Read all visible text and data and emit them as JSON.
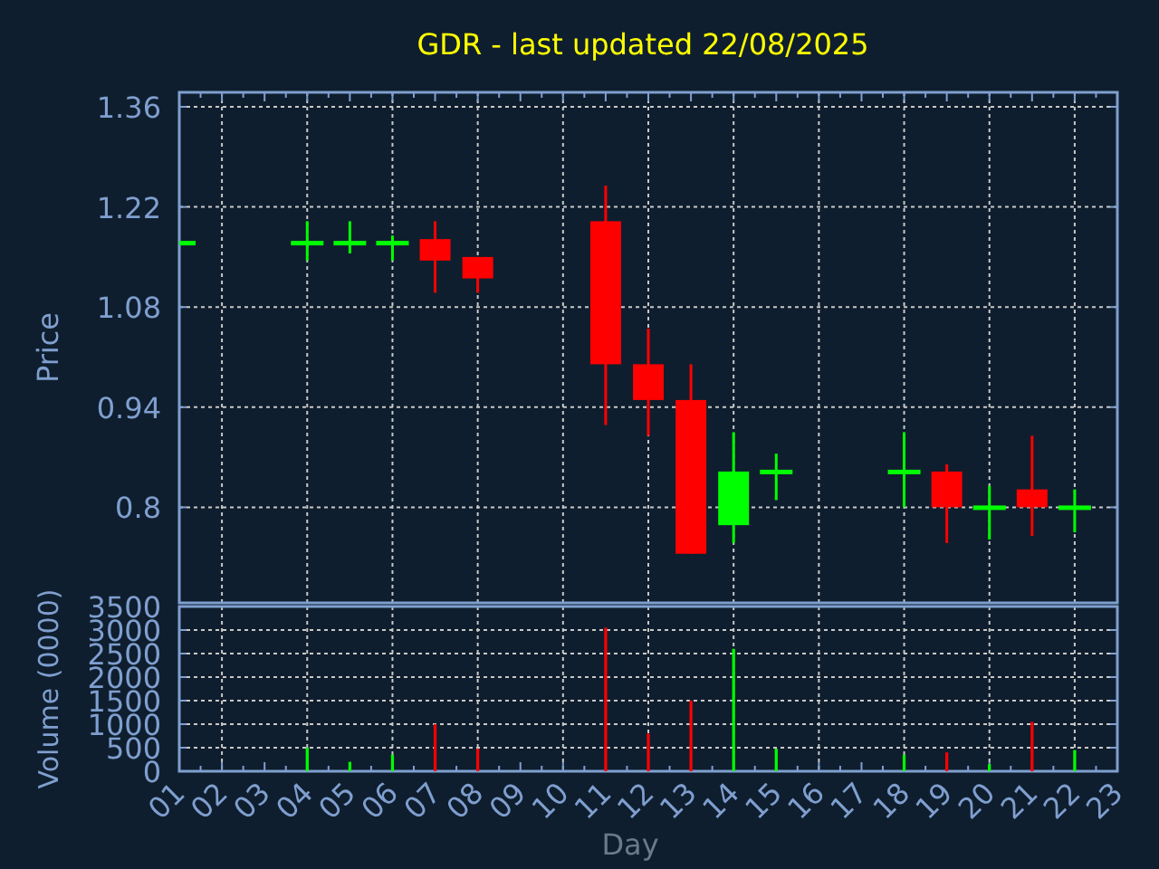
{
  "chart": {
    "title": "GDR - last updated 22/08/2025",
    "price_panel": {
      "ylabel": "Price",
      "ytick_labels": [
        "1.36",
        "1.22",
        "1.08",
        "0.94",
        "0.8"
      ]
    },
    "volume_panel": {
      "chart_data": {
        "type": "bar",
        "xlabel": "Day",
        "ylabel": "Volume (0000)",
        "grid": true,
        "categories": [
          "01",
          "02",
          "03",
          "04",
          "05",
          "06",
          "07",
          "08",
          "09",
          "10",
          "11",
          "12",
          "13",
          "14",
          "15",
          "16",
          "17",
          "18",
          "19",
          "20",
          "21",
          "22",
          "23"
        ],
        "series": [
          {
            "color": "#00ff00",
            "values": [
              null,
              null,
              null,
              500,
              200,
              350,
              null,
              null,
              null,
              null,
              null,
              null,
              null,
              2600,
              480,
              null,
              null,
              350,
              null,
              150,
              null,
              450,
              null
            ]
          },
          {
            "color": "#ff0000",
            "values": [
              null,
              null,
              null,
              null,
              null,
              null,
              1000,
              480,
              null,
              null,
              3050,
              800,
              1500,
              null,
              null,
              null,
              null,
              null,
              400,
              null,
              1050,
              null,
              null
            ]
          }
        ],
        "ylim": [
          0,
          3500
        ],
        "yticks": [
          0,
          500,
          1000,
          1500,
          2000,
          2500,
          3000,
          3500
        ]
      }
    }
  }
}
